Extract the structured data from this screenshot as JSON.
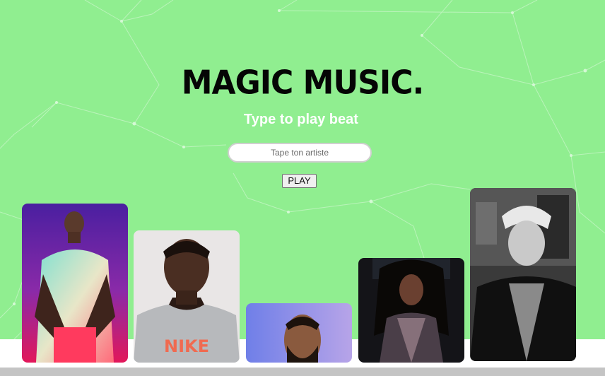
{
  "brand": {
    "logo_text": "MAGIC MUSIC."
  },
  "hero": {
    "subtitle": "Type to play beat"
  },
  "search": {
    "placeholder": "Tape ton artiste",
    "value": ""
  },
  "controls": {
    "play_label": "PLAY"
  },
  "artists": [
    {
      "id": "artist-1",
      "tone": "purple-pink gradient, person in pastel shirt"
    },
    {
      "id": "artist-2",
      "tone": "light background, person in grey sweatshirt"
    },
    {
      "id": "artist-3",
      "tone": "blue-lilac background, bearded person"
    },
    {
      "id": "artist-4",
      "tone": "dark background, person with curly hair"
    },
    {
      "id": "artist-5",
      "tone": "black and white, person in leather jacket"
    }
  ],
  "colors": {
    "background": "#90ee90",
    "title": "#050505",
    "subtitle": "#ffffff"
  }
}
